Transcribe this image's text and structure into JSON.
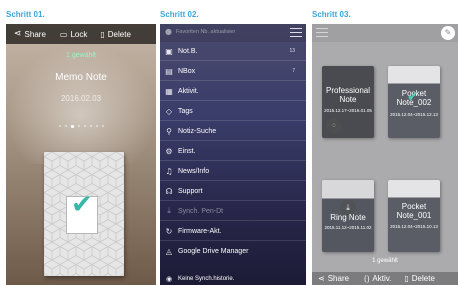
{
  "steps": [
    "Schritt 01.",
    "Schritt 02.",
    "Schritt 03."
  ],
  "panel1": {
    "toolbar": {
      "share": "Share",
      "lock": "Lock",
      "delete": "Delete"
    },
    "selected_count": "1 gewählt",
    "note_title": "Memo Note",
    "note_date": "2016.02.03"
  },
  "panel2": {
    "search_placeholder": "Favoriten Nb. aktualisier",
    "menu": [
      {
        "icon": "notebook-icon",
        "label": "Not.B.",
        "count": "13"
      },
      {
        "icon": "inbox-icon",
        "label": "NBox",
        "count": "7"
      },
      {
        "icon": "calendar-icon",
        "label": "Aktivit."
      },
      {
        "icon": "tag-icon",
        "label": "Tags"
      },
      {
        "icon": "search-icon",
        "label": "Notiz-Suche"
      },
      {
        "icon": "gear-icon",
        "label": "Einst."
      },
      {
        "icon": "bell-icon",
        "label": "News/Info"
      },
      {
        "icon": "headset-icon",
        "label": "Support"
      },
      {
        "icon": "download-icon",
        "label": "Synch. Pen-Dt"
      },
      {
        "icon": "refresh-icon",
        "label": "Firmware-Akt."
      },
      {
        "icon": "drive-icon",
        "label": "Google Drive Manager"
      }
    ],
    "footer_label": "Keine Synch.historie."
  },
  "panel3": {
    "cards": [
      {
        "name": "Professional Note",
        "date": "2015.12.17~2016.01.05"
      },
      {
        "name": "Pocket Note_002",
        "date": "2015.12.04~2015.12.13"
      },
      {
        "name": "Ring Note",
        "date": "2015.11.12~2015.11.02"
      },
      {
        "name": "Pocket Note_001",
        "date": "2015.12.04~2015.10.13"
      }
    ],
    "selected_count": "1 gewählt",
    "actions": {
      "share": "Share",
      "activity": "Aktiv.",
      "delete": "Delete"
    }
  },
  "colors": {
    "step_label": "#3aa6d8",
    "selected_text": "#9ef0c8",
    "check": "#39b8a8"
  }
}
